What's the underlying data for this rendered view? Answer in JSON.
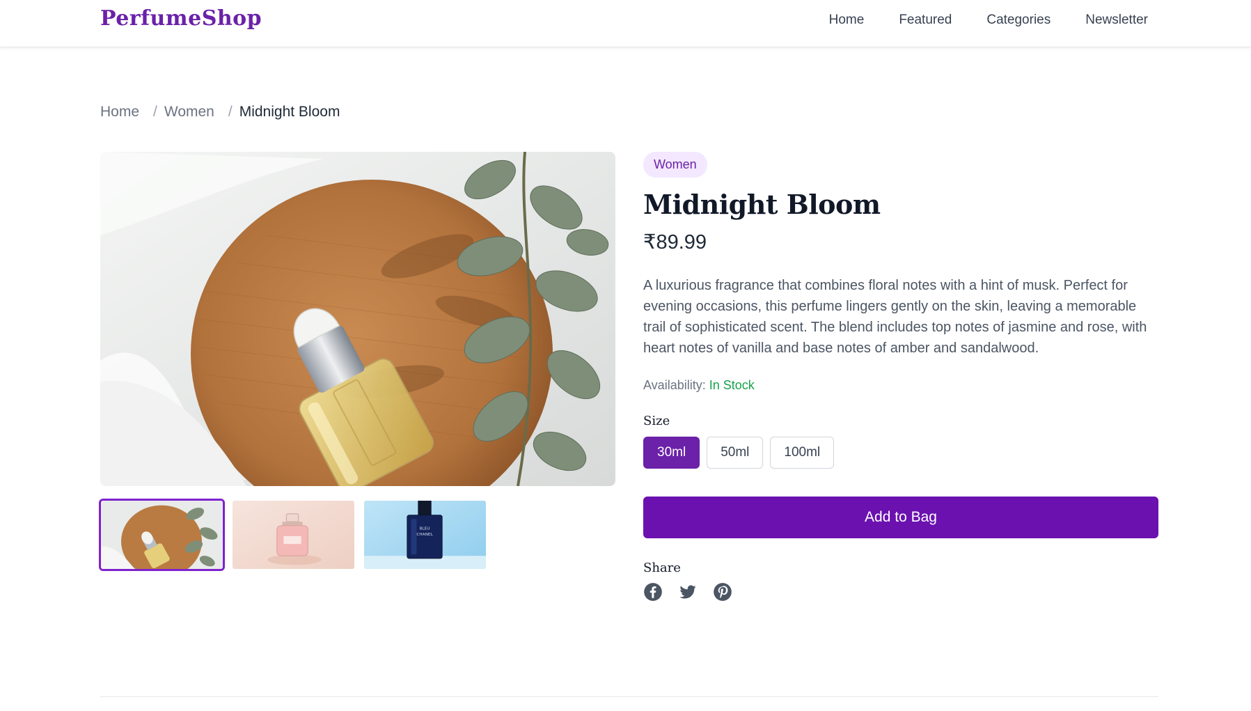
{
  "header": {
    "logo": "PerfumeShop",
    "nav": [
      "Home",
      "Featured",
      "Categories",
      "Newsletter"
    ]
  },
  "breadcrumb": {
    "items": [
      "Home",
      "Women"
    ],
    "separator": "/",
    "current": "Midnight Bloom"
  },
  "product": {
    "category": "Women",
    "title": "Midnight Bloom",
    "price": "₹89.99",
    "description": "A luxurious fragrance that combines floral notes with a hint of musk. Perfect for evening occasions, this perfume lingers gently on the skin, leaving a memorable trail of sophisticated scent. The blend includes top notes of jasmine and rose, with heart notes of vanilla and base notes of amber and sandalwood.",
    "availability_label": "Availability:",
    "availability_value": "In Stock",
    "size_label": "Size",
    "sizes": [
      "30ml",
      "50ml",
      "100ml"
    ],
    "selected_size": "30ml",
    "add_button": "Add to Bag",
    "share_label": "Share",
    "share_icons": [
      "facebook-icon",
      "twitter-icon",
      "pinterest-icon"
    ]
  },
  "gallery": {
    "images": [
      "perfume-dropper-bottle",
      "pink-perfume-bottle",
      "blue-perfume-bottle"
    ],
    "active_index": 0
  },
  "colors": {
    "brand": "#6b21a8",
    "button": "#6b11b0",
    "badge_bg": "#f3e8ff",
    "in_stock": "#16a34a"
  }
}
